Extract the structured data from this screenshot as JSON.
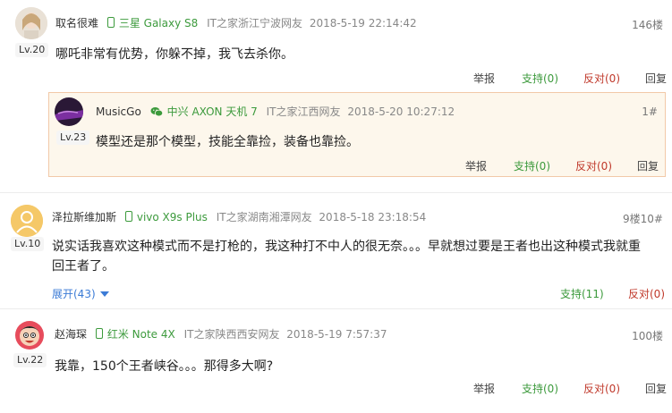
{
  "comments": [
    {
      "user": "取名很难",
      "level": "Lv.20",
      "device": "三星 Galaxy S8",
      "location": "IT之家浙江宁波网友",
      "time": "2018-5-19 22:14:42",
      "floor": "146楼",
      "content": "哪吒非常有优势，你躲不掉，我飞去杀你。",
      "report": "举报",
      "support": "支持(0)",
      "oppose": "反对(0)",
      "reply": "回复"
    },
    {
      "user": "泽拉斯维加斯",
      "level": "Lv.10",
      "device": "vivo X9s Plus",
      "location": "IT之家湖南湘潭网友",
      "time": "2018-5-18 23:18:54",
      "floor": "9楼10#",
      "content_line1": "说实话我喜欢这种模式而不是打枪的，我这种打不中人的很无奈。。。早就想过要是王者也出这种模式我就重",
      "content_line2": "回王者了。",
      "expand": "展开(43)",
      "support": "支持(11)",
      "oppose": "反对(0)"
    },
    {
      "user": "赵海琛",
      "level": "Lv.22",
      "device": "红米 Note 4X",
      "location": "IT之家陕西西安网友",
      "time": "2018-5-19 7:57:37",
      "floor": "100楼",
      "content": "我靠，150个王者峡谷。。。那得多大啊?",
      "report": "举报",
      "support": "支持(0)",
      "oppose": "反对(0)",
      "reply": "回复"
    }
  ],
  "nested_reply": {
    "user": "MusicGo",
    "level": "Lv.23",
    "device": "中兴 AXON 天机 7",
    "location": "IT之家江西网友",
    "time": "2018-5-20 10:27:12",
    "floor": "1#",
    "content": "模型还是那个模型，技能全靠捡，装备也靠捡。",
    "report": "举报",
    "support": "支持(0)",
    "oppose": "反对(0)",
    "reply": "回复"
  },
  "colors": {
    "device_green": "#3c9a3c",
    "support_green": "#3c9a3c",
    "oppose_red": "#c0392b",
    "expand_blue": "#3b7bd6",
    "nested_bg": "#fdf7ec",
    "nested_border": "#f2c9a8"
  }
}
